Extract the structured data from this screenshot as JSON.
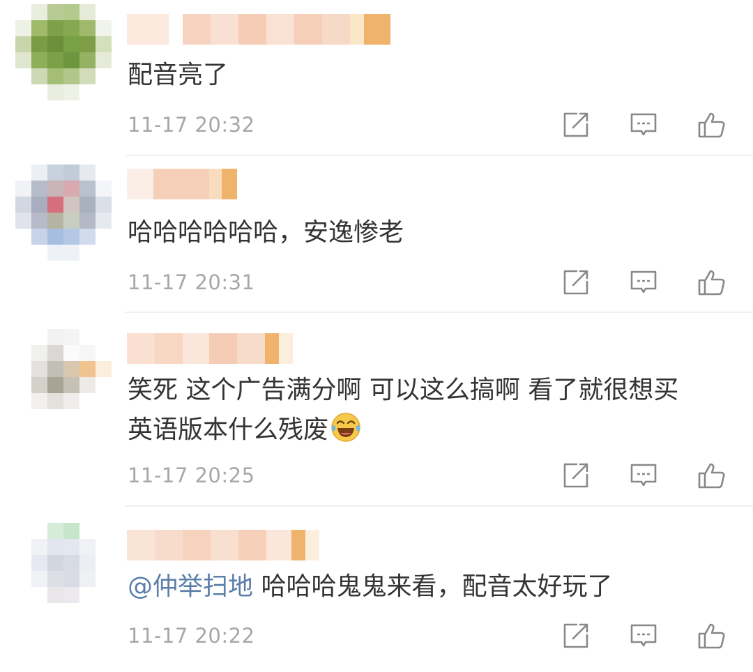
{
  "comments": [
    {
      "text": "配音亮了",
      "time": "11-17 20:32"
    },
    {
      "text": "哈哈哈哈哈哈，安逸惨老",
      "time": "11-17 20:31"
    },
    {
      "text_line1": "笑死 这个广告满分啊 可以这么搞啊 看了就很想买",
      "text_line2": "英语版本什么残废",
      "emoji": "laughing-crying-emoji",
      "time": "11-17 20:25"
    },
    {
      "mention": "@仲举扫地",
      "text": " 哈哈哈鬼鬼来看，配音太好玩了",
      "time": "11-17 20:22"
    }
  ],
  "icons": {
    "share": "share-icon",
    "reply": "comment-icon",
    "like": "thumbs-up-icon"
  },
  "colors": {
    "text": "#333333",
    "meta": "#a7a7a7",
    "mention": "#5b7ea8",
    "divider": "#efefef",
    "icon": "#888888"
  }
}
